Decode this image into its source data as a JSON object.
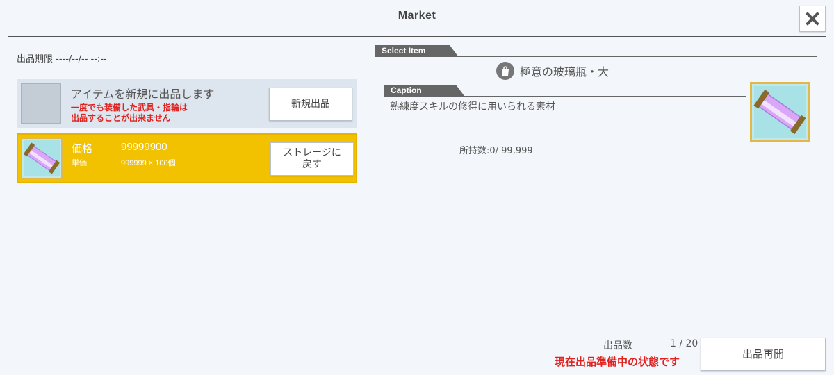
{
  "header": {
    "title": "Market"
  },
  "listing": {
    "deadline_text": "出品期限 ----/--/-- --:--",
    "new_row": {
      "title": "アイテムを新規に出品します",
      "warning_line1": "一度でも装備した武具・指輪は",
      "warning_line2": "出品することが出来ません",
      "button": "新規出品"
    },
    "item_row": {
      "price_label": "価格",
      "price_value": "99999900",
      "unit_label": "単価",
      "unit_value": "999999 × 100個",
      "button_line1": "ストレージに",
      "button_line2": "戻す"
    }
  },
  "detail": {
    "select_tab": "Select Item",
    "item_name": "極意の玻璃瓶・大",
    "caption_tab": "Caption",
    "caption_text": "熟練度スキルの修得に用いられる素材",
    "owned": "所持数:0/ 99,999"
  },
  "footer": {
    "count_label": "出品数",
    "count_value": "1 / 20",
    "status": "現在出品準備中の状態です",
    "resume_button": "出品再開"
  },
  "colors": {
    "background": "#f3f6fa",
    "selected_row": "#f2c200",
    "warning": "#e0211e",
    "tab": "#666666"
  }
}
